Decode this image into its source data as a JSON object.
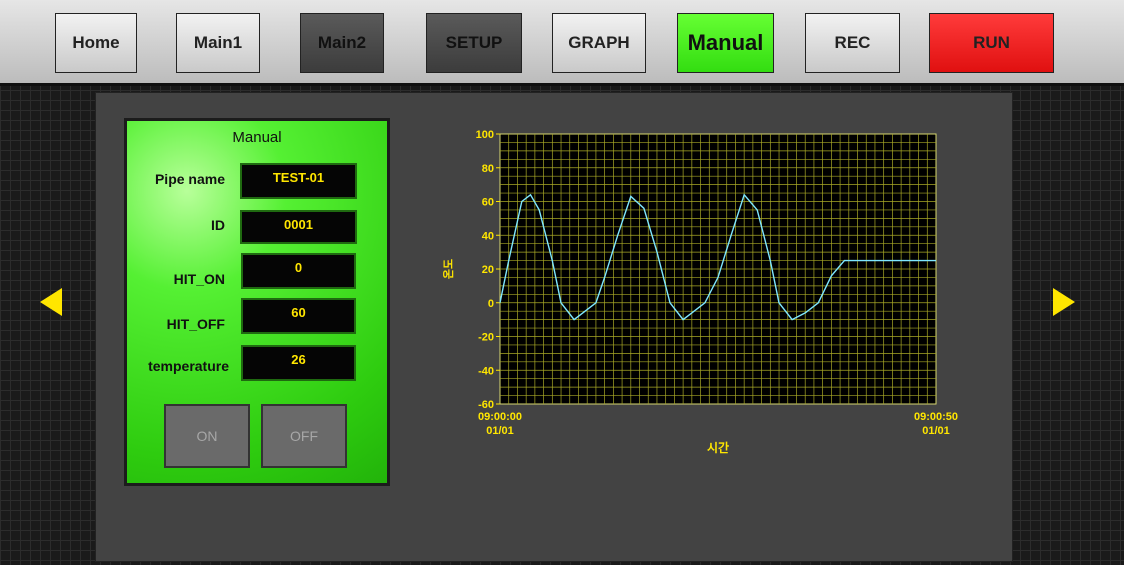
{
  "nav": {
    "home": "Home",
    "main1": "Main1",
    "main2": "Main2",
    "setup": "SETUP",
    "graph": "GRAPH",
    "manual": "Manual",
    "rec": "REC",
    "run": "RUN"
  },
  "colors": {
    "accent_green": "#33dd11",
    "run_red": "#ff1a1a",
    "value_yellow": "#ffe600",
    "trace_cyan": "#7fe7ff"
  },
  "icons": {
    "left": "left-triangle-icon",
    "right": "right-triangle-icon"
  },
  "panel": {
    "title": "Manual",
    "fields": [
      {
        "label": "Pipe name",
        "value": "TEST-01"
      },
      {
        "label": "ID",
        "value": "0001"
      },
      {
        "label": "HIT_ON",
        "value": "0"
      },
      {
        "label": "HIT_OFF",
        "value": "60"
      },
      {
        "label": "temperature",
        "value": "26"
      }
    ],
    "on_label": "ON",
    "off_label": "OFF"
  },
  "chart_data": {
    "type": "line",
    "ylabel": "온도",
    "xlabel": "시간",
    "x_tick_labels": [
      {
        "time": "09:00:00",
        "date": "01/01"
      },
      {
        "time": "09:00:50",
        "date": "01/01"
      }
    ],
    "xlim": [
      0,
      50
    ],
    "ylim": [
      -60,
      100
    ],
    "y_ticks": [
      100,
      80,
      60,
      40,
      20,
      0,
      -20,
      -40,
      -60
    ],
    "grid": true,
    "series": [
      {
        "x": [
          0,
          1,
          2.5,
          3.5,
          4.5,
          6,
          7,
          8.5,
          9.5,
          11,
          12,
          13.5,
          15,
          16.5,
          18,
          19.5,
          21,
          22,
          23.5,
          25,
          26.5,
          28,
          29.5,
          31,
          32,
          33.5,
          35,
          36.5,
          38,
          39.5,
          41,
          42,
          43.5,
          45,
          47,
          50
        ],
        "y": [
          0,
          25,
          60,
          64,
          55,
          25,
          0,
          -10,
          -6,
          0,
          15,
          40,
          63,
          56,
          30,
          0,
          -10,
          -6,
          0,
          15,
          40,
          64,
          55,
          25,
          0,
          -10,
          -6,
          0,
          16,
          25,
          25,
          25,
          25,
          25,
          25,
          25
        ]
      }
    ]
  }
}
